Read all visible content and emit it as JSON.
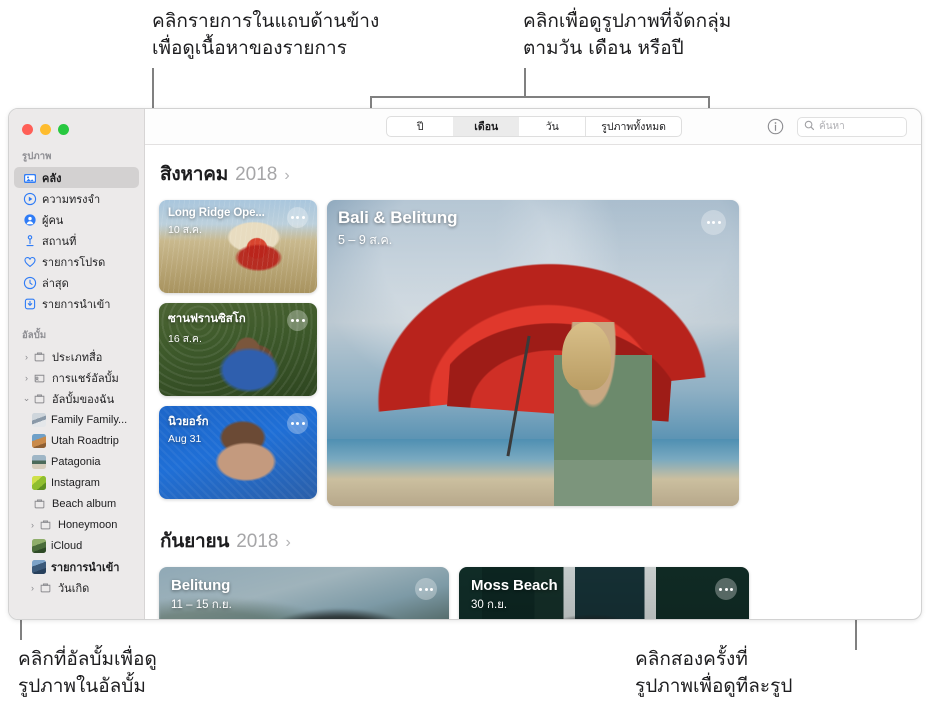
{
  "callouts": {
    "sidebar": "คลิกรายการในแถบด้านข้าง\nเพื่อดูเนื้อหาของรายการ",
    "groups": "คลิกเพื่อดูรูปภาพที่จัดกลุ่ม\nตามวัน เดือน หรือปี",
    "albums": "คลิกที่อัลบั้มเพื่อดู\nรูปภาพในอัลบั้ม",
    "double_click": "คลิกสองครั้งที่\nรูปภาพเพื่อดูทีละรูป"
  },
  "window": {
    "traffic_lights": {
      "close": "close-button",
      "minimize": "minimize-button",
      "zoom": "zoom-button"
    }
  },
  "sidebar": {
    "groups": [
      {
        "title": "รูปภาพ",
        "items": [
          {
            "label": "คลัง",
            "icon": "photo-library-icon",
            "selected": true
          },
          {
            "label": "ความทรงจำ",
            "icon": "memories-icon",
            "selected": false
          },
          {
            "label": "ผู้คน",
            "icon": "people-icon",
            "selected": false
          },
          {
            "label": "สถานที่",
            "icon": "places-pin-icon",
            "selected": false
          },
          {
            "label": "รายการโปรด",
            "icon": "heart-icon",
            "selected": false
          },
          {
            "label": "ล่าสุด",
            "icon": "clock-icon",
            "selected": false
          },
          {
            "label": "รายการนำเข้า",
            "icon": "import-download-icon",
            "selected": false
          }
        ]
      },
      {
        "title": "อัลบั้ม",
        "items": [
          {
            "label": "ประเภทสื่อ",
            "icon": "folder-icon",
            "disclosure": "collapsed",
            "indent": false
          },
          {
            "label": "การแชร์อัลบั้ม",
            "icon": "shared-album-icon",
            "disclosure": "collapsed",
            "indent": false
          },
          {
            "label": "อัลบั้มของฉัน",
            "icon": "folder-icon",
            "disclosure": "expanded",
            "indent": false
          },
          {
            "label": "Family Family...",
            "thumb": "th-family",
            "indent": true
          },
          {
            "label": "Utah Roadtrip",
            "thumb": "th-utah",
            "indent": true
          },
          {
            "label": "Patagonia",
            "thumb": "th-patag",
            "indent": true
          },
          {
            "label": "Instagram",
            "thumb": "th-insta",
            "indent": true
          },
          {
            "label": "Beach album",
            "icon": "album-icon",
            "indent": true
          },
          {
            "label": "Honeymoon",
            "icon": "folder-icon",
            "disclosure": "collapsed",
            "indent": true
          },
          {
            "label": "iCloud",
            "thumb": "th-icloud",
            "indent": true
          },
          {
            "label": "รายการนำเข้า",
            "thumb": "th-import",
            "indent": true,
            "bold": true
          },
          {
            "label": "วันเกิด",
            "icon": "folder-icon",
            "disclosure": "collapsed",
            "indent": true
          }
        ]
      }
    ]
  },
  "toolbar": {
    "segments": [
      {
        "label": "ปี",
        "active": false
      },
      {
        "label": "เดือน",
        "active": true
      },
      {
        "label": "วัน",
        "active": false
      },
      {
        "label": "รูปภาพทั้งหมด",
        "active": false
      }
    ],
    "info_icon": "info-icon",
    "search": {
      "icon": "search-icon",
      "placeholder": "ค้นหา",
      "value": ""
    }
  },
  "content": {
    "sections": [
      {
        "month": "สิงหาคม",
        "year": "2018",
        "chevron": "›",
        "small_cards": [
          {
            "title": "Long Ridge Ope...",
            "date": "10 ส.ค.",
            "scene": "scene-field"
          },
          {
            "title": "ซานฟรานซิสโก",
            "date": "16 ส.ค.",
            "scene": "scene-portrait-green"
          },
          {
            "title": "นิวยอร์ก",
            "date": "Aug 31",
            "scene": "scene-portrait-blue"
          }
        ],
        "big_card": {
          "title": "Bali & Belitung",
          "date": "5 – 9 ส.ค.",
          "scene": "scene-umbrella"
        }
      },
      {
        "month": "กันยายน",
        "year": "2018",
        "chevron": "›",
        "wide_cards": [
          {
            "title": "Belitung",
            "date": "11 – 15 ก.ย.",
            "scene": "scene-belitung"
          },
          {
            "title": "Moss Beach",
            "date": "30 ก.ย.",
            "scene": "scene-moss"
          }
        ]
      }
    ]
  },
  "colors": {
    "sidebar_bg": "#eceaea",
    "selection": "#d3d1d1",
    "accent_blue": "#2f7cf6",
    "callout_line": "#808080"
  }
}
